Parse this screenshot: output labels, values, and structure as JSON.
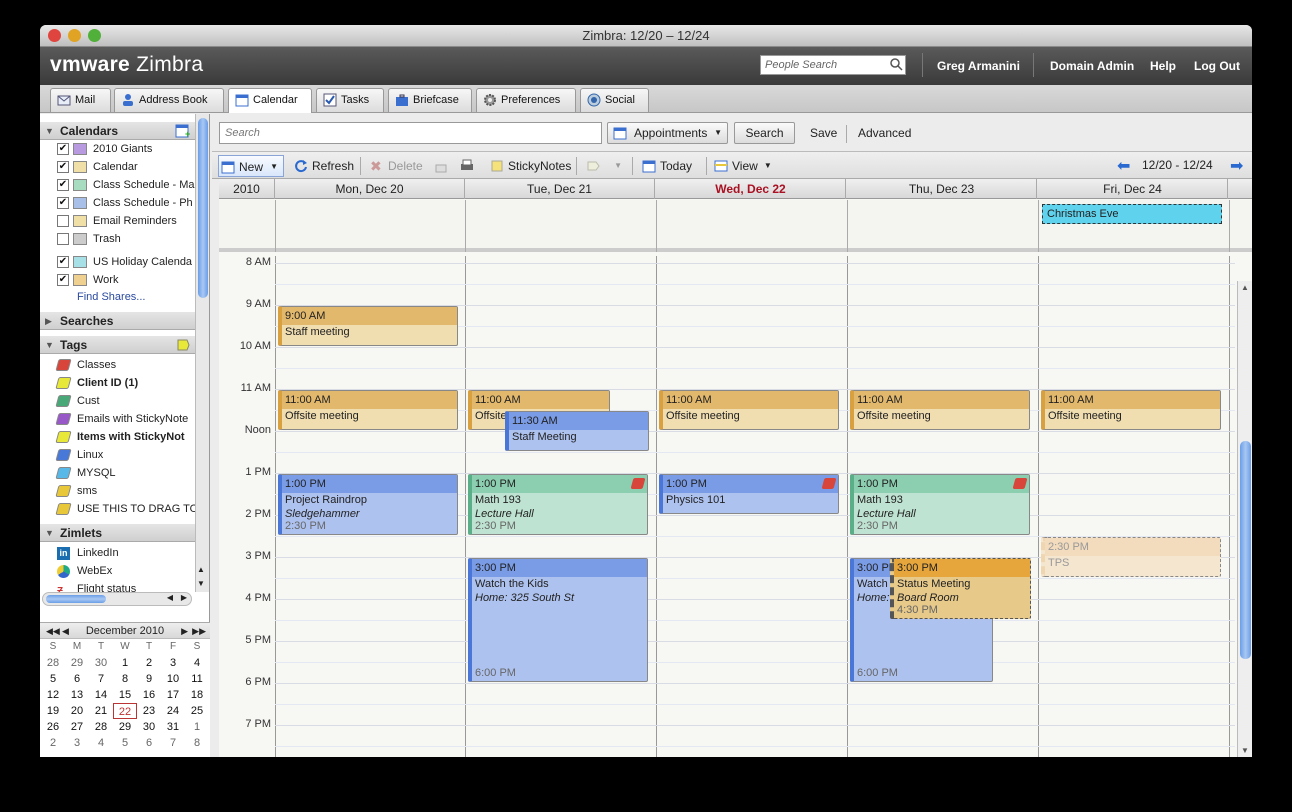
{
  "window": {
    "title": "Zimbra: 12/20 – 12/24"
  },
  "header": {
    "logo_vm": "vmware",
    "logo_zimbra": "Zimbra",
    "people_search_placeholder": "People Search",
    "user": "Greg Armanini",
    "domain_admin": "Domain Admin",
    "help": "Help",
    "logout": "Log Out"
  },
  "tabs": [
    {
      "label": "Mail"
    },
    {
      "label": "Address Book"
    },
    {
      "label": "Calendar"
    },
    {
      "label": "Tasks"
    },
    {
      "label": "Briefcase"
    },
    {
      "label": "Preferences"
    },
    {
      "label": "Social"
    }
  ],
  "sidebar": {
    "calendars_title": "Calendars",
    "calendars": [
      {
        "label": "2010 Giants",
        "checked": true,
        "color": "#b89ae0"
      },
      {
        "label": "Calendar",
        "checked": true,
        "color": "#f0e0a8"
      },
      {
        "label": "Class Schedule - Ma",
        "checked": true,
        "color": "#a8dcc0"
      },
      {
        "label": "Class Schedule - Ph",
        "checked": true,
        "color": "#a8c0e8"
      },
      {
        "label": "Email Reminders",
        "checked": false,
        "color": "#f0e0a8"
      },
      {
        "label": "Trash",
        "checked": false,
        "color": "#cccccc"
      },
      {
        "label": "US Holiday Calenda",
        "checked": true,
        "color": "#a8e0e8"
      },
      {
        "label": "Work",
        "checked": true,
        "color": "#f0d090"
      }
    ],
    "find_shares": "Find Shares...",
    "searches_title": "Searches",
    "tags_title": "Tags",
    "tags": [
      {
        "label": "Classes",
        "color": "#d8453b",
        "bold": false
      },
      {
        "label": "Client ID (1)",
        "color": "#e8e838",
        "bold": true
      },
      {
        "label": "Cust",
        "color": "#48a878",
        "bold": false
      },
      {
        "label": "Emails with StickyNote",
        "color": "#9858c8",
        "bold": false
      },
      {
        "label": "Items with StickyNot",
        "color": "#e8e838",
        "bold": true
      },
      {
        "label": "Linux",
        "color": "#4878d8",
        "bold": false
      },
      {
        "label": "MYSQL",
        "color": "#58b8e8",
        "bold": false
      },
      {
        "label": "sms",
        "color": "#e8c838",
        "bold": false
      },
      {
        "label": "USE THIS TO DRAG TO",
        "color": "#e8c838",
        "bold": false
      }
    ],
    "zimlets_title": "Zimlets",
    "zimlets": [
      {
        "label": "LinkedIn"
      },
      {
        "label": "WebEx"
      },
      {
        "label": "Flight status"
      }
    ]
  },
  "minical": {
    "month": "December 2010",
    "dows": [
      "S",
      "M",
      "T",
      "W",
      "T",
      "F",
      "S"
    ],
    "weeks": [
      [
        "28",
        "29",
        "30",
        "1",
        "2",
        "3",
        "4"
      ],
      [
        "5",
        "6",
        "7",
        "8",
        "9",
        "10",
        "11"
      ],
      [
        "12",
        "13",
        "14",
        "15",
        "16",
        "17",
        "18"
      ],
      [
        "19",
        "20",
        "21",
        "22",
        "23",
        "24",
        "25"
      ],
      [
        "26",
        "27",
        "28",
        "29",
        "30",
        "31",
        "1"
      ],
      [
        "2",
        "3",
        "4",
        "5",
        "6",
        "7",
        "8"
      ]
    ],
    "today": "22"
  },
  "searchbar": {
    "placeholder": "Search",
    "type": "Appointments",
    "search_btn": "Search",
    "save": "Save",
    "advanced": "Advanced"
  },
  "toolbar": {
    "new": "New",
    "refresh": "Refresh",
    "delete": "Delete",
    "stickynotes": "StickyNotes",
    "today": "Today",
    "view": "View",
    "range": "12/20 - 12/24"
  },
  "calendar": {
    "year": "2010",
    "days": [
      "Mon, Dec 20",
      "Tue, Dec 21",
      "Wed, Dec 22",
      "Thu, Dec 23",
      "Fri, Dec 24"
    ],
    "today_index": 2,
    "hours": [
      "8 AM",
      "9 AM",
      "10 AM",
      "11 AM",
      "Noon",
      "1 PM",
      "2 PM",
      "3 PM",
      "4 PM",
      "5 PM",
      "6 PM",
      "7 PM"
    ],
    "allday": [
      {
        "day": 4,
        "title": "Christmas Eve"
      }
    ],
    "events": [
      {
        "day": 0,
        "time": "9:00 AM",
        "title": "Staff meeting",
        "start": 9,
        "end": 10,
        "style": "work"
      },
      {
        "day": 0,
        "time": "11:00 AM",
        "title": "Offsite meeting",
        "start": 11,
        "end": 12,
        "style": "work"
      },
      {
        "day": 1,
        "time": "11:00 AM",
        "title": "Offsite meeting",
        "start": 11,
        "end": 12,
        "style": "work",
        "narrow": true
      },
      {
        "day": 1,
        "time": "11:30 AM",
        "title": "Staff Meeting",
        "start": 11.5,
        "end": 12.5,
        "style": "blue",
        "offset": true
      },
      {
        "day": 2,
        "time": "11:00 AM",
        "title": "Offsite meeting",
        "start": 11,
        "end": 12,
        "style": "work"
      },
      {
        "day": 3,
        "time": "11:00 AM",
        "title": "Offsite meeting",
        "start": 11,
        "end": 12,
        "style": "work"
      },
      {
        "day": 4,
        "time": "11:00 AM",
        "title": "Offsite meeting",
        "start": 11,
        "end": 12,
        "style": "work"
      },
      {
        "day": 0,
        "time": "1:00 PM",
        "title": "Project Raindrop",
        "loc": "Sledgehammer",
        "endlbl": "2:30 PM",
        "start": 13,
        "end": 14.5,
        "style": "blue"
      },
      {
        "day": 1,
        "time": "1:00 PM",
        "title": "Math 193",
        "loc": "Lecture Hall",
        "endlbl": "2:30 PM",
        "start": 13,
        "end": 14.5,
        "style": "green",
        "tag": true
      },
      {
        "day": 2,
        "time": "1:00 PM",
        "title": "Physics 101",
        "start": 13,
        "end": 14,
        "style": "blue",
        "tag": true
      },
      {
        "day": 3,
        "time": "1:00 PM",
        "title": "Math 193",
        "loc": "Lecture Hall",
        "endlbl": "2:30 PM",
        "start": 13,
        "end": 14.5,
        "style": "green",
        "tag": true
      },
      {
        "day": 4,
        "time": "2:30 PM",
        "title": "TPS",
        "start": 14.5,
        "end": 15.5,
        "style": "ghost"
      },
      {
        "day": 1,
        "time": "3:00 PM",
        "title": "Watch the Kids",
        "loc": "Home: 325 South St",
        "endlbl": "6:00 PM",
        "start": 15,
        "end": 18,
        "style": "blue"
      },
      {
        "day": 3,
        "time": "3:00 PM",
        "title": "Watch the Kids",
        "loc": "Home: 325 South St",
        "endlbl": "6:00 PM",
        "start": 15,
        "end": 18,
        "style": "blue",
        "narrow2": true
      },
      {
        "day": 3,
        "time": "3:00 PM",
        "title": "Status Meeting",
        "loc": "Board Room",
        "endlbl": "4:30 PM",
        "start": 15,
        "end": 16.5,
        "style": "orange",
        "offset2": true
      }
    ]
  }
}
